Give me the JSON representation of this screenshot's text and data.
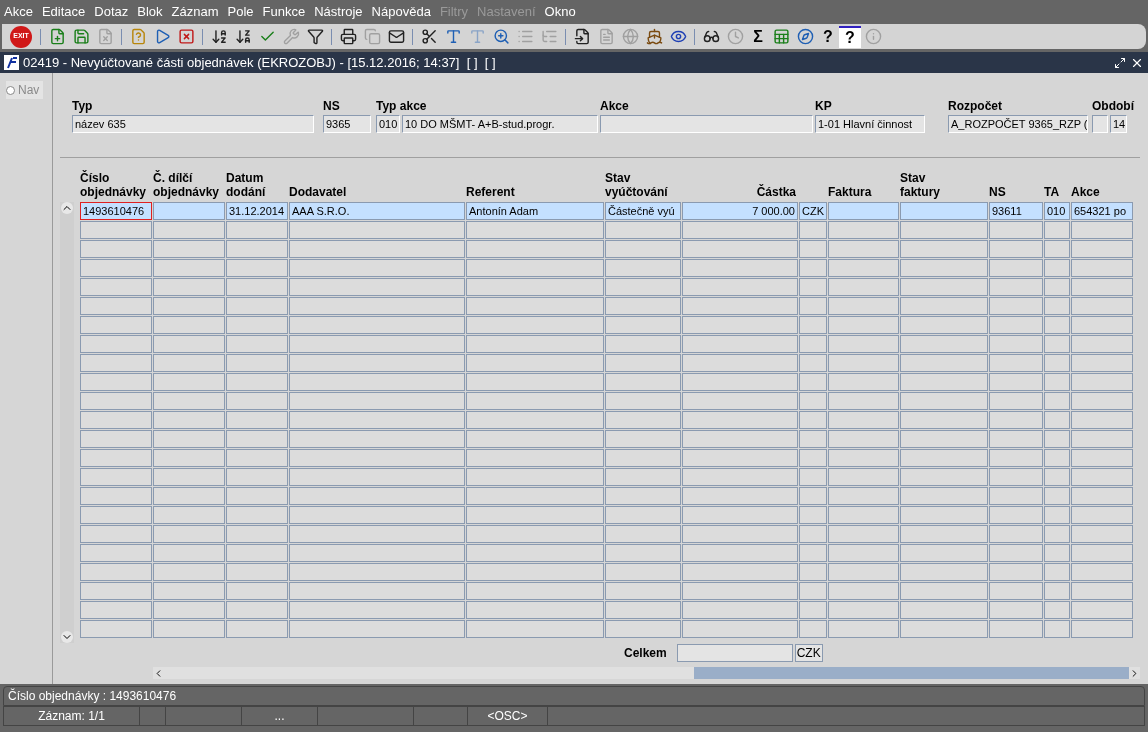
{
  "menu": [
    {
      "label": "Akce",
      "disabled": false
    },
    {
      "label": "Editace",
      "disabled": false
    },
    {
      "label": "Dotaz",
      "disabled": false
    },
    {
      "label": "Blok",
      "disabled": false
    },
    {
      "label": "Záznam",
      "disabled": false
    },
    {
      "label": "Pole",
      "disabled": false
    },
    {
      "label": "Funkce",
      "disabled": false
    },
    {
      "label": "Nástroje",
      "disabled": false
    },
    {
      "label": "Nápověda",
      "disabled": false
    },
    {
      "label": "Filtry",
      "disabled": true
    },
    {
      "label": "Nastavení",
      "disabled": true
    },
    {
      "label": "Okno",
      "disabled": false
    }
  ],
  "toolbar": [
    {
      "kind": "exit",
      "label": "EXIT",
      "disabled": false
    },
    {
      "kind": "sep"
    },
    {
      "kind": "add",
      "disabled": false
    },
    {
      "kind": "save",
      "disabled": false
    },
    {
      "kind": "remove",
      "disabled": true
    },
    {
      "kind": "sep"
    },
    {
      "kind": "query",
      "disabled": false
    },
    {
      "kind": "run",
      "disabled": false
    },
    {
      "kind": "cancel",
      "disabled": false
    },
    {
      "kind": "sep"
    },
    {
      "kind": "sortasc",
      "disabled": false
    },
    {
      "kind": "sortdesc",
      "disabled": false
    },
    {
      "kind": "check",
      "disabled": false
    },
    {
      "kind": "wrench",
      "disabled": true
    },
    {
      "kind": "filter",
      "disabled": false
    },
    {
      "kind": "sep"
    },
    {
      "kind": "print",
      "disabled": false
    },
    {
      "kind": "copies",
      "disabled": true
    },
    {
      "kind": "mail",
      "disabled": false
    },
    {
      "kind": "sep"
    },
    {
      "kind": "cut",
      "disabled": false
    },
    {
      "kind": "text",
      "disabled": false
    },
    {
      "kind": "text",
      "disabled": true
    },
    {
      "kind": "zoom",
      "disabled": false
    },
    {
      "kind": "list",
      "disabled": true
    },
    {
      "kind": "tree",
      "disabled": true
    },
    {
      "kind": "sep"
    },
    {
      "kind": "import",
      "disabled": false
    },
    {
      "kind": "doc",
      "disabled": true
    },
    {
      "kind": "globe",
      "disabled": true
    },
    {
      "kind": "wheel",
      "disabled": false
    },
    {
      "kind": "eye",
      "disabled": false
    },
    {
      "kind": "sep"
    },
    {
      "kind": "glasses",
      "disabled": false
    },
    {
      "kind": "clock",
      "disabled": true
    },
    {
      "kind": "sigma",
      "label": "Σ",
      "disabled": false
    },
    {
      "kind": "excel",
      "disabled": false
    },
    {
      "kind": "browser",
      "disabled": false
    },
    {
      "kind": "help",
      "label": "?",
      "disabled": false
    },
    {
      "kind": "helpwin",
      "label": "?",
      "disabled": false
    },
    {
      "kind": "info",
      "disabled": true
    }
  ],
  "window": {
    "title": "02419 - Nevyúčtované části objednávek (EKROZOBJ) - [15.12.2016; 14:37]  [ ]  [ ]"
  },
  "nav": {
    "label": "Nav",
    "selected": false
  },
  "header": [
    {
      "label": "Typ",
      "values": [
        "název 635"
      ]
    },
    {
      "label": "NS",
      "values": [
        "9365"
      ]
    },
    {
      "label": "Typ akce",
      "values": [
        "010",
        "10 DO MŠMT- A+B-stud.progr."
      ]
    },
    {
      "label": "Akce"
    },
    {
      "label": "KP",
      "values": [
        "1-01 Hlavní činnost"
      ]
    },
    {
      "label": "Rozpočet",
      "values": [
        "A_ROZPOČET 9365_RZP ("
      ]
    },
    {
      "label": "Období",
      "values": [
        "14"
      ]
    }
  ],
  "table": {
    "columns": [
      "Číslo\nobjednávky",
      "Č. dílčí\nobjednávky",
      "Datum\ndodání",
      "Dodavatel",
      "Referent",
      "Stav\nvyúčtování",
      "Částka",
      "",
      "Faktura",
      "Stav\nfaktury",
      "NS",
      "TA",
      "Akce"
    ],
    "rows": [
      {
        "selected": true,
        "cells": [
          "1493610476",
          "",
          "31.12.2014",
          "AAA S.R.O.",
          "Antonín Adam",
          "Částečně vyú",
          "7 000.00",
          "CZK",
          "",
          "",
          "93611",
          "010",
          "654321 po"
        ]
      }
    ]
  },
  "total": {
    "label": "Celkem",
    "currency": "CZK"
  },
  "status": {
    "message": "Číslo objednávky : 1493610476",
    "segments": [
      "Záznam: 1/1",
      "...",
      "<OSC>"
    ]
  }
}
